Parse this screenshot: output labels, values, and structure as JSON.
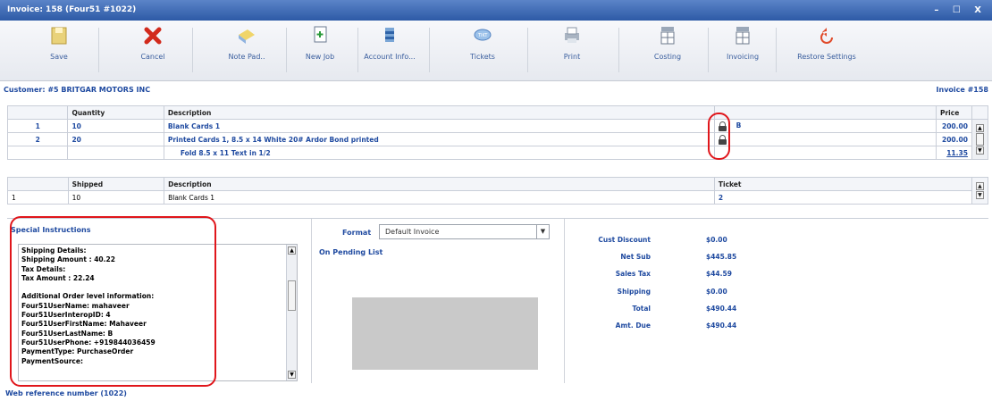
{
  "window": {
    "title": "Invoice: 158 (Four51 #1022)",
    "controls": "– ☐ X"
  },
  "toolbar": [
    {
      "label": "Save"
    },
    {
      "label": "Cancel"
    },
    {
      "label": "Note Pad.."
    },
    {
      "label": "New Job"
    },
    {
      "label": "Account Info..."
    },
    {
      "label": "Tickets"
    },
    {
      "label": "Print"
    },
    {
      "label": "Costing"
    },
    {
      "label": "Invoicing"
    },
    {
      "label": "Restore Settings"
    }
  ],
  "header": {
    "customer": "Customer: #5  BRITGAR MOTORS INC",
    "invoice": "Invoice #158"
  },
  "items": {
    "columns": [
      "",
      "Quantity",
      "Description",
      "",
      "Price"
    ],
    "rows": [
      {
        "num": "1",
        "qty": "10",
        "desc": "Blank Cards 1",
        "extra": "B",
        "price": "200.00"
      },
      {
        "num": "2",
        "qty": "20",
        "desc": "Printed Cards 1, 8.5 x 14 White 20# Ardor Bond printed",
        "extra": "",
        "price": "200.00"
      },
      {
        "num": "",
        "qty": "",
        "desc": "Fold 8.5 x 11 Text in 1/2",
        "extra": "",
        "price": "11.35"
      }
    ]
  },
  "shipments": {
    "columns": [
      "",
      "Shipped",
      "Description",
      "Ticket"
    ],
    "rows": [
      {
        "num": "1",
        "shipped": "10",
        "desc": "Blank Cards 1",
        "ticket": "2"
      }
    ]
  },
  "special": {
    "title": "Special Instructions",
    "lines": [
      "Shipping Details:",
      "Shipping Amount : 40.22",
      "Tax Details:",
      "Tax Amount : 22.24",
      "",
      "Additional Order level information:",
      "Four51UserName: mahaveer",
      "Four51UserInteropID: 4",
      "Four51UserFirstName: Mahaveer",
      "Four51UserLastName: B",
      "Four51UserPhone: +919844036459",
      "PaymentType: PurchaseOrder",
      "PaymentSource:"
    ]
  },
  "format": {
    "label": "Format",
    "selected": "Default Invoice",
    "pending": "On Pending List"
  },
  "totals": [
    {
      "label": "Cust Discount",
      "value": "$0.00"
    },
    {
      "label": "Net Sub",
      "value": "$445.85"
    },
    {
      "label": "Sales Tax",
      "value": "$44.59"
    },
    {
      "label": "Shipping",
      "value": "$0.00"
    },
    {
      "label": "Total",
      "value": "$490.44"
    },
    {
      "label": "Amt. Due",
      "value": "$490.44"
    }
  ],
  "footer": {
    "webref": "Web reference number (1022)"
  }
}
